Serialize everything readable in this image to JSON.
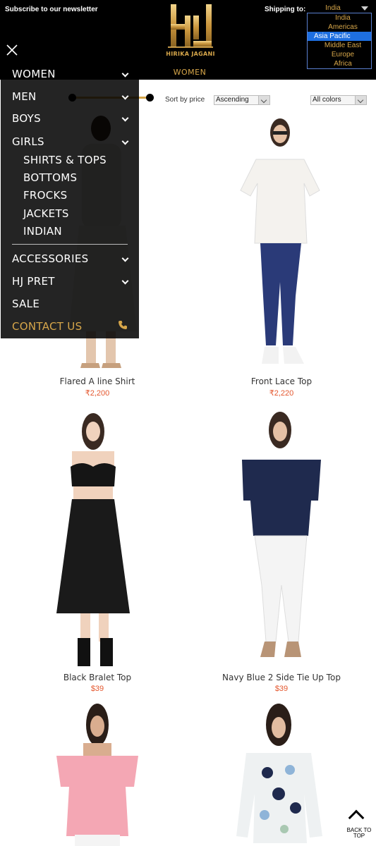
{
  "header": {
    "newsletter": "Subscribe to our newsletter",
    "brand": "HIRIKA JAGANI",
    "section": "WOMEN",
    "shipping_label": "Shipping to:",
    "shipping_selected": "India",
    "shipping_options": [
      "India",
      "Americas",
      "Asia Pacific",
      "Middle East",
      "Europe",
      "Africa"
    ],
    "shipping_active": "Asia Pacific"
  },
  "filters": {
    "sort_label": "Sort by price",
    "sort_value": "Ascending",
    "color_value": "All colors"
  },
  "menu": {
    "items": [
      "WOMEN",
      "MEN",
      "BOYS",
      "GIRLS"
    ],
    "girls_sub": [
      "SHIRTS & TOPS",
      "BOTTOMS",
      "FROCKS",
      "JACKETS",
      "INDIAN"
    ],
    "more": [
      "ACCESSORIES",
      "HJ PRET",
      "SALE"
    ],
    "contact": "CONTACT US"
  },
  "products": [
    {
      "name": "Flared A line Shirt",
      "price": "₹2,200"
    },
    {
      "name": "Front Lace Top",
      "price": "₹2,220"
    },
    {
      "name": "Black Bralet Top",
      "price": "$39"
    },
    {
      "name": "Navy Blue 2 Side Tie Up Top",
      "price": "$39"
    },
    {
      "name": "",
      "price": ""
    },
    {
      "name": "",
      "price": ""
    }
  ],
  "back_to_top": "BACK TO TOP",
  "colors": {
    "gold": "#d6a64a",
    "price": "#e4572e",
    "header_bg": "#000000"
  }
}
